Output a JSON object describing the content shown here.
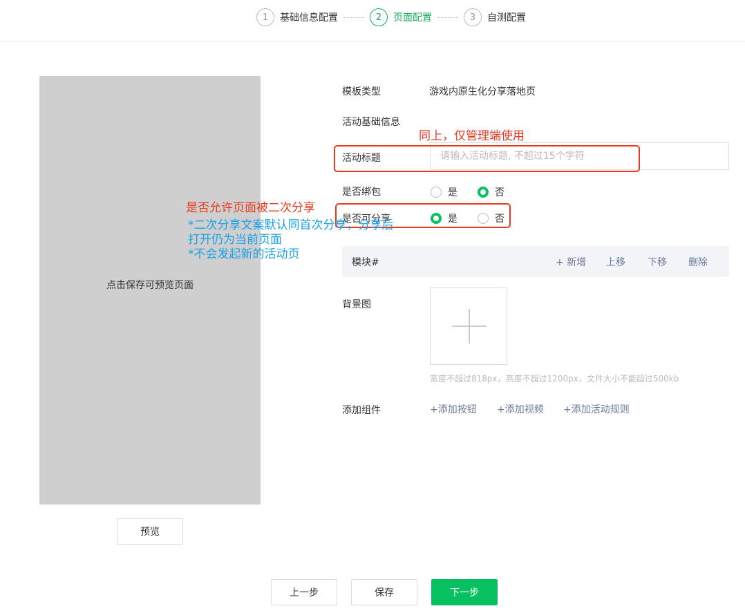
{
  "stepper": {
    "steps": [
      {
        "num": "1",
        "label": "基础信息配置"
      },
      {
        "num": "2",
        "label": "页面配置"
      },
      {
        "num": "3",
        "label": "自测配置"
      }
    ]
  },
  "preview": {
    "placeholder_text": "点击保存可预览页面",
    "preview_button": "预览"
  },
  "form": {
    "template_type_label": "模板类型",
    "template_type_value": "游戏内原生化分享落地页",
    "basic_info_label": "活动基础信息",
    "title_label": "活动标题",
    "title_placeholder": "请输入活动标题, 不超过15个字符",
    "title_value": "",
    "bind_package_label": "是否绑包",
    "bind_package_options": [
      "是",
      "否"
    ],
    "bind_package_selected": "否",
    "shareable_label": "是否可分享",
    "shareable_options": [
      "是",
      "否"
    ],
    "shareable_selected": "是",
    "module": {
      "title": "模块#",
      "add": "+ 新增",
      "move_up": "上移",
      "move_down": "下移",
      "delete": "删除"
    },
    "background_label": "背景图",
    "background_hint": "宽度不超过818px，高度不超过1200px，文件大小不能超过500kb",
    "add_component_label": "添加组件",
    "add_button": "+添加按钮",
    "add_video": "+添加视频",
    "add_rules": "+添加活动规则"
  },
  "footer": {
    "prev": "上一步",
    "save": "保存",
    "next": "下一步"
  },
  "annotations": {
    "title_note": "同上，仅管理端使用",
    "share_note": "是否允许页面被二次分享",
    "share_detail": [
      "*二次分享文案默认同首次分享，分享后",
      "打开仍为当前页面",
      "*不会发起新的活动页"
    ]
  },
  "colors": {
    "primary_green": "#07c160",
    "annotation_red": "#e8391f",
    "annotation_blue": "#1aa0e6",
    "link": "#6b7a99"
  }
}
